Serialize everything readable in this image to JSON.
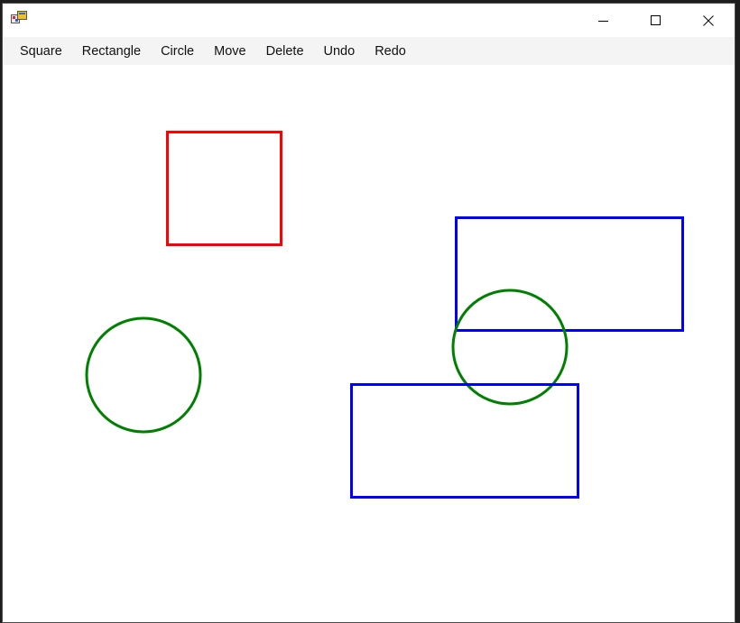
{
  "window": {
    "icon": "winforms-app-icon",
    "controls": {
      "minimize": "minimize-icon",
      "maximize": "maximize-icon",
      "close": "close-icon"
    }
  },
  "menu": {
    "items": [
      {
        "label": "Square",
        "key": "square"
      },
      {
        "label": "Rectangle",
        "key": "rectangle"
      },
      {
        "label": "Circle",
        "key": "circle"
      },
      {
        "label": "Move",
        "key": "move"
      },
      {
        "label": "Delete",
        "key": "delete"
      },
      {
        "label": "Undo",
        "key": "undo"
      },
      {
        "label": "Redo",
        "key": "redo"
      }
    ]
  },
  "canvas": {
    "shapes": [
      {
        "type": "square",
        "color": "#ff0000"
      },
      {
        "type": "rectangle",
        "color": "#0000ff"
      },
      {
        "type": "circle",
        "color": "#008000"
      },
      {
        "type": "circle",
        "color": "#008000"
      },
      {
        "type": "rectangle",
        "color": "#0000ff"
      }
    ]
  }
}
